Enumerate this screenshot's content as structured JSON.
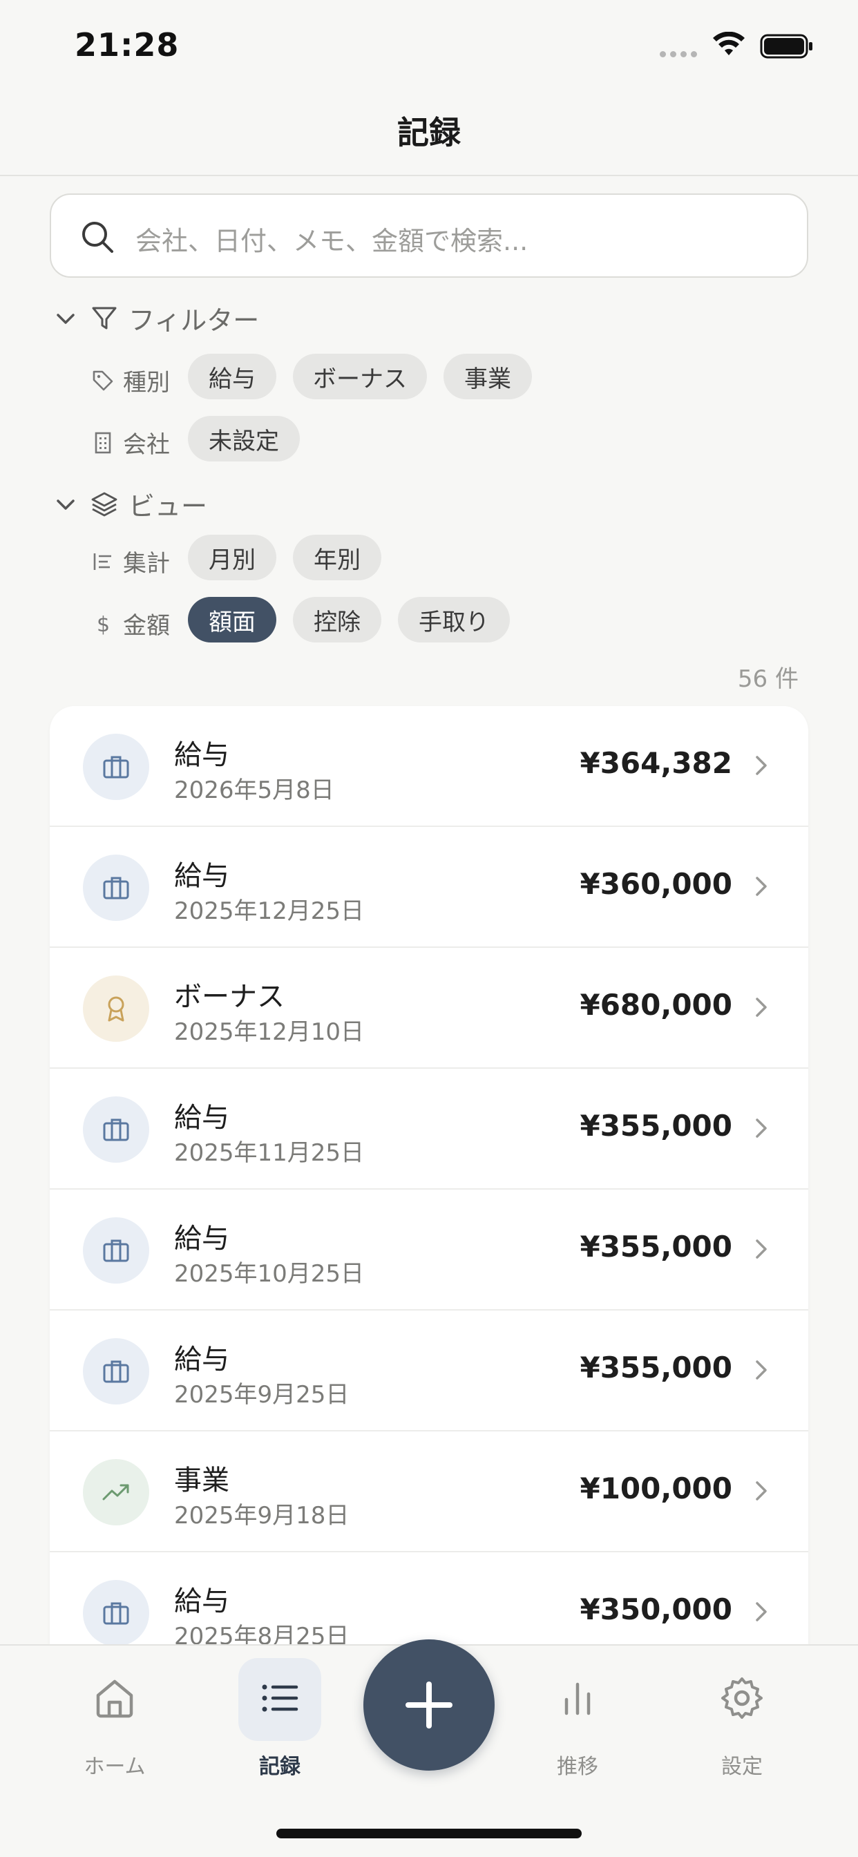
{
  "status_bar": {
    "time": "21:28"
  },
  "nav": {
    "title": "記録"
  },
  "search": {
    "placeholder": "会社、日付、メモ、金額で検索..."
  },
  "filter": {
    "header": "フィルター",
    "type_label": "種別",
    "type_chips": [
      "給与",
      "ボーナス",
      "事業"
    ],
    "company_label": "会社",
    "company_chips": [
      "未設定"
    ]
  },
  "view": {
    "header": "ビュー",
    "aggregate_label": "集計",
    "aggregate_chips": [
      "月別",
      "年別"
    ],
    "amount_label": "金額",
    "amount_chips": [
      "額面",
      "控除",
      "手取り"
    ],
    "amount_selected": "額面"
  },
  "count": "56 件",
  "records": [
    {
      "title": "給与",
      "date": "2026年5月8日",
      "amount": "¥364,382",
      "icon": "briefcase-icon"
    },
    {
      "title": "給与",
      "date": "2025年12月25日",
      "amount": "¥360,000",
      "icon": "briefcase-icon"
    },
    {
      "title": "ボーナス",
      "date": "2025年12月10日",
      "amount": "¥680,000",
      "icon": "award-icon"
    },
    {
      "title": "給与",
      "date": "2025年11月25日",
      "amount": "¥355,000",
      "icon": "briefcase-icon"
    },
    {
      "title": "給与",
      "date": "2025年10月25日",
      "amount": "¥355,000",
      "icon": "briefcase-icon"
    },
    {
      "title": "給与",
      "date": "2025年9月25日",
      "amount": "¥355,000",
      "icon": "briefcase-icon"
    },
    {
      "title": "事業",
      "date": "2025年9月18日",
      "amount": "¥100,000",
      "icon": "trending-up-icon"
    },
    {
      "title": "給与",
      "date": "2025年8月25日",
      "amount": "¥350,000",
      "icon": "briefcase-icon"
    }
  ],
  "tabs": [
    {
      "label": "ホーム",
      "icon": "home-icon"
    },
    {
      "label": "記録",
      "icon": "list-icon"
    },
    {
      "label": "推移",
      "icon": "bar-chart-icon"
    },
    {
      "label": "設定",
      "icon": "gear-icon"
    }
  ],
  "colors": {
    "accent": "#425165",
    "salary": "#5a78a0",
    "bonus": "#c9a25a",
    "business": "#6c9a70"
  }
}
